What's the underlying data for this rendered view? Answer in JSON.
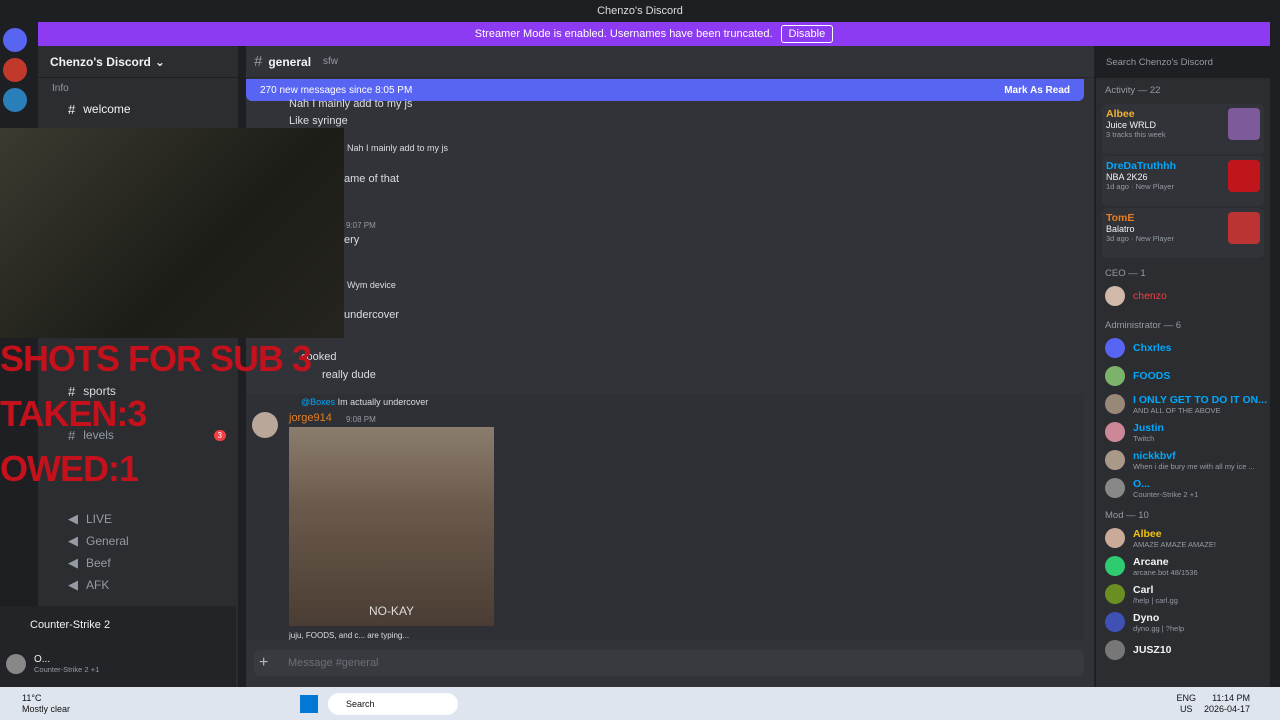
{
  "window": {
    "title": "Chenzo's Discord"
  },
  "banner": {
    "text": "Streamer Mode is enabled. Usernames have been truncated.",
    "button": "Disable"
  },
  "server": {
    "name": "Chenzo's Discord",
    "category": "Info",
    "channels": [
      "welcome",
      "sports",
      "levels"
    ],
    "voice": [
      "LIVE",
      "General",
      "Beef",
      "AFK"
    ],
    "levels_badge": "3"
  },
  "channel": {
    "name": "general",
    "topic": "sfw",
    "search": "Search Chenzo's Discord"
  },
  "newbar": {
    "text": "270 new messages since 8:05 PM",
    "action": "Mark As Read"
  },
  "messages": [
    {
      "text": "Nah I mainly add to my js"
    },
    {
      "text": "Like syringe"
    },
    {
      "text": "Nah I mainly add to my js"
    },
    {
      "text": "ame of that"
    },
    {
      "text": "9:07 PM"
    },
    {
      "text": "ery"
    },
    {
      "text": "Wym device"
    },
    {
      "text": "undercover"
    },
    {
      "text": "cooked"
    },
    {
      "text": "really dude"
    }
  ],
  "reply": {
    "to": "@Boxes",
    "text": "Im actually undercover",
    "author": "jorge914",
    "time": "9:08 PM",
    "gif_caption": "NO-KAY"
  },
  "typing": "juju, FOODS, and c... are typing...",
  "composer": {
    "placeholder": "Message #general"
  },
  "activity": {
    "title": "Activity — 22",
    "items": [
      {
        "user": "Albee",
        "game": "Juice WRLD",
        "sub": "3 tracks this week",
        "color": "#f0b232"
      },
      {
        "user": "DreDaTruthhh",
        "game": "NBA 2K26",
        "sub": "1d ago · New Player",
        "color": "#00a8fc"
      },
      {
        "user": "TomE",
        "game": "Balatro",
        "sub": "3d ago · New Player",
        "color": "#e67e22"
      }
    ]
  },
  "members": {
    "ceo": {
      "title": "CEO — 1",
      "list": [
        {
          "name": "chenzo",
          "color": "#f23f43",
          "sub": ""
        }
      ]
    },
    "admin": {
      "title": "Administrator — 6",
      "list": [
        {
          "name": "Chxrles",
          "color": "#00a8fc",
          "sub": ""
        },
        {
          "name": "FOODS",
          "color": "#00a8fc",
          "sub": ""
        },
        {
          "name": "I ONLY GET TO DO IT ON...",
          "color": "#00a8fc",
          "sub": "AND ALL OF THE ABOVE"
        },
        {
          "name": "Justin",
          "color": "#00a8fc",
          "sub": "Twitch"
        },
        {
          "name": "nickkbvf",
          "color": "#00a8fc",
          "sub": "When i die bury me with all my ice ..."
        },
        {
          "name": "O...",
          "color": "#00a8fc",
          "sub": "Counter-Strike 2 +1"
        }
      ]
    },
    "mod": {
      "title": "Mod — 10",
      "list": [
        {
          "name": "Albee",
          "color": "#f1c40f",
          "sub": "AMAZE AMAZE AMAZE!"
        },
        {
          "name": "Arcane",
          "color": "#f2f3f5",
          "sub": "arcane.bot 48/1536"
        },
        {
          "name": "Carl",
          "color": "#f2f3f5",
          "sub": "/help | carl.gg"
        },
        {
          "name": "Dyno",
          "color": "#f2f3f5",
          "sub": "dyno.gg | ?help"
        },
        {
          "name": "JUSZ10",
          "color": "#f2f3f5",
          "sub": ""
        }
      ]
    }
  },
  "userbar": {
    "activity": "Counter-Strike 2",
    "user": "O...",
    "status": "Counter-Strike 2 +1"
  },
  "overlay": {
    "line1": "SHOTS FOR SUB 3",
    "line2": "TAKEN:3",
    "line3": "OWED:1"
  },
  "taskbar": {
    "weather": "11°C",
    "weather_desc": "Mostly clear",
    "search": "Search",
    "lang1": "ENG",
    "lang2": "US",
    "time": "11:14 PM",
    "date": "2026-04-17"
  }
}
